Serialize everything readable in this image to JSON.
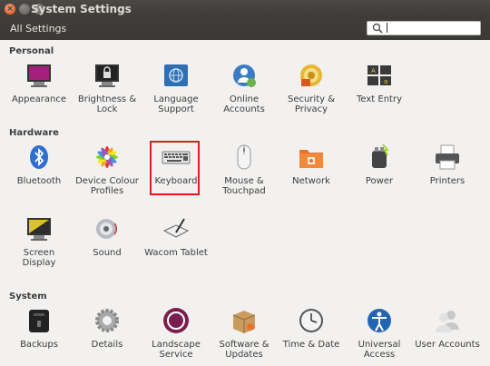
{
  "window": {
    "title": "System Settings"
  },
  "toolbar": {
    "all_settings": "All Settings",
    "search_value": ""
  },
  "sections": {
    "personal": "Personal",
    "hardware": "Hardware",
    "system": "System"
  },
  "items": {
    "appearance": "Appearance",
    "brightness": "Brightness & Lock",
    "language": "Language Support",
    "online": "Online Accounts",
    "security": "Security & Privacy",
    "textentry": "Text Entry",
    "bluetooth": "Bluetooth",
    "colour": "Device Colour Profiles",
    "keyboard": "Keyboard",
    "mouse": "Mouse & Touchpad",
    "network": "Network",
    "power": "Power",
    "printers": "Printers",
    "screen": "Screen Display",
    "sound": "Sound",
    "wacom": "Wacom Tablet",
    "backups": "Backups",
    "details": "Details",
    "landscape": "Landscape Service",
    "software": "Software & Updates",
    "time": "Time & Date",
    "access": "Universal Access",
    "users": "User Accounts"
  },
  "colors": {
    "titlebar": "#3c3b37",
    "selection": "#e21b1b",
    "background": "#f2f1f0"
  }
}
